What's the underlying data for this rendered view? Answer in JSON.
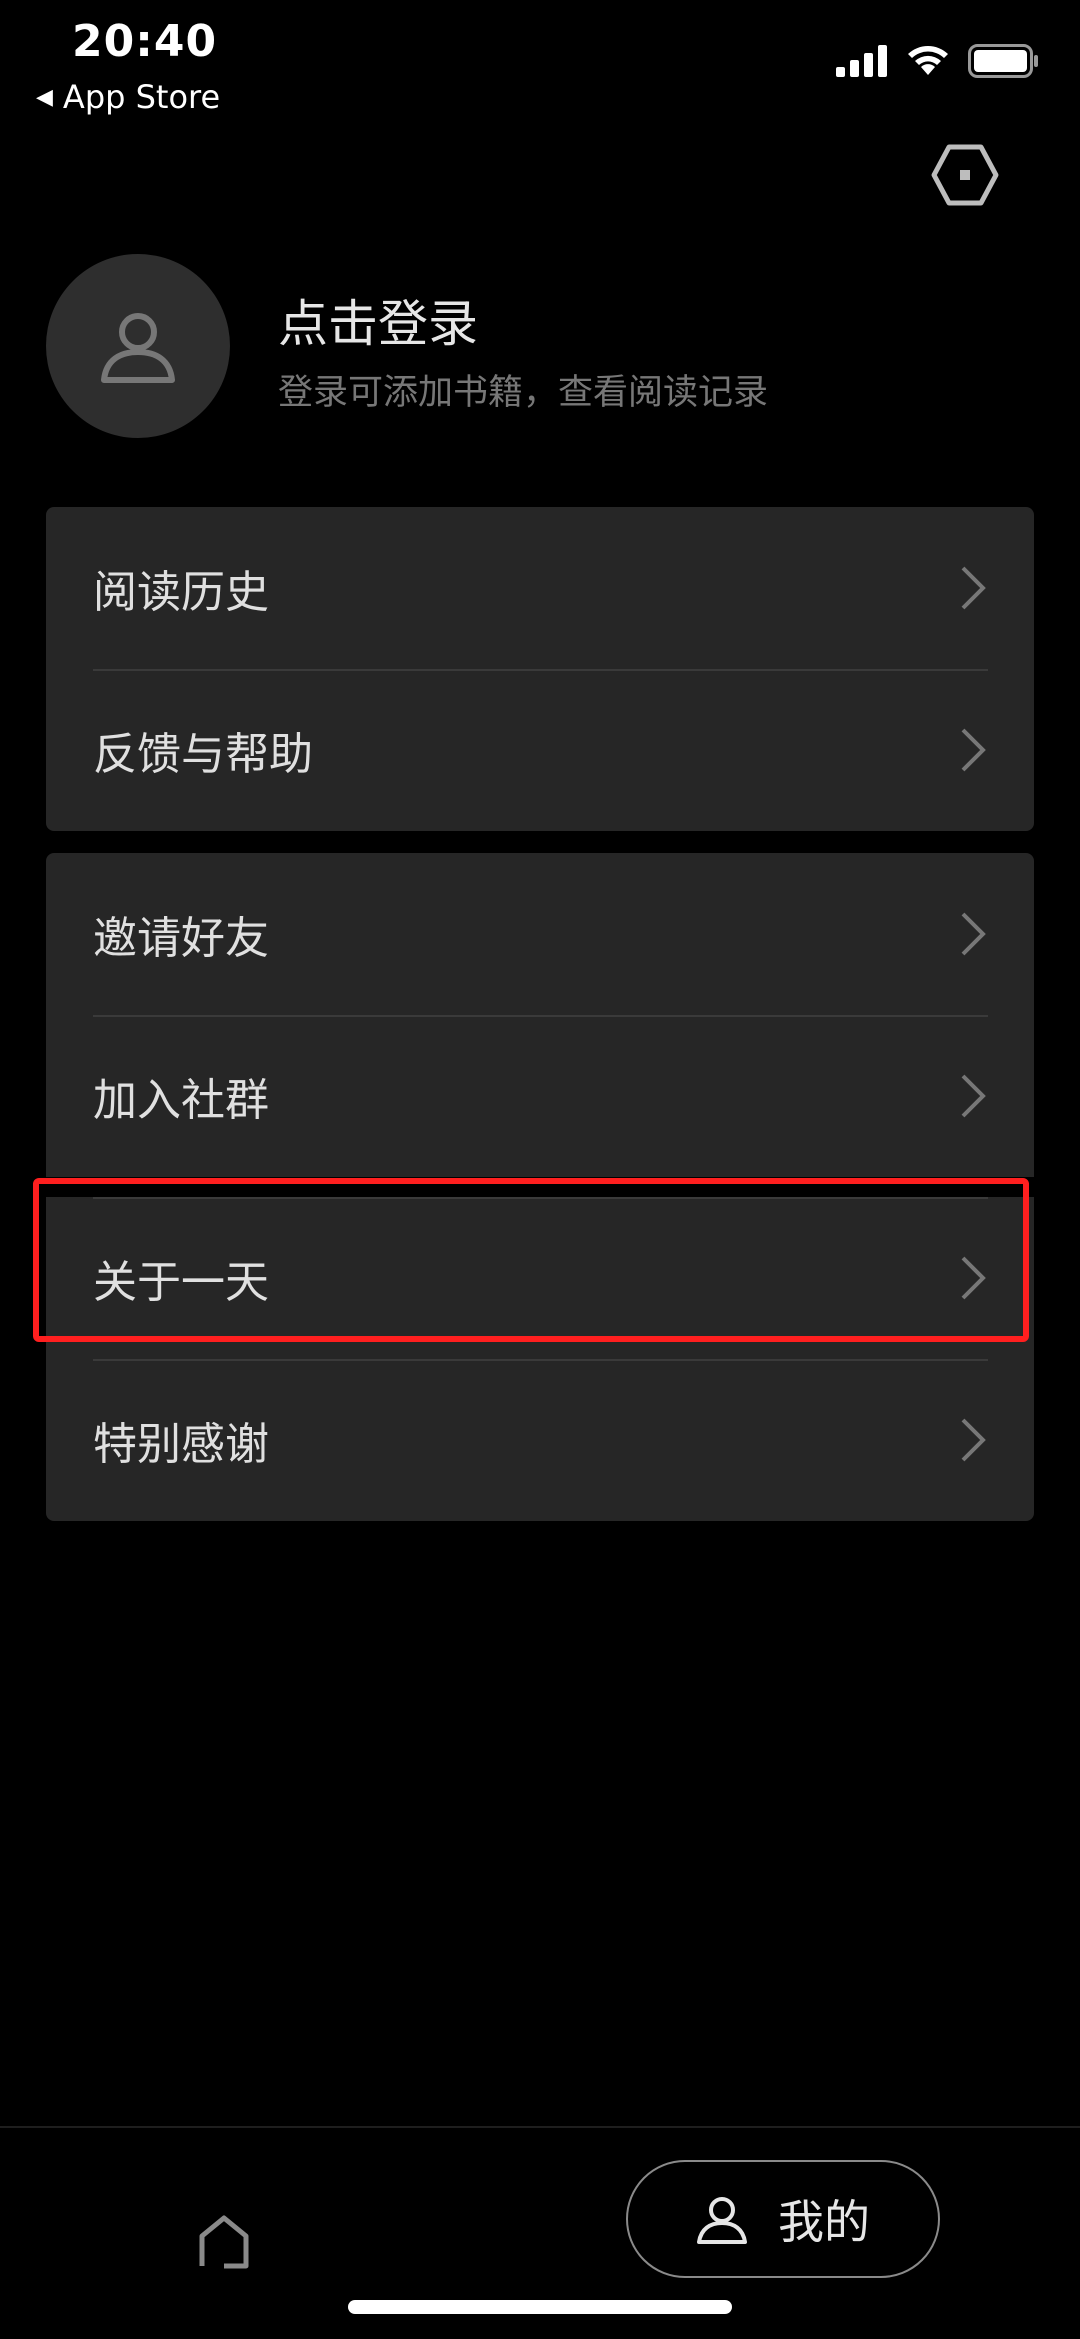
{
  "status_bar": {
    "time": "20:40",
    "back_label": "App Store",
    "signal_icon": "signal-icon",
    "wifi_icon": "wifi-icon",
    "battery_icon": "battery-icon"
  },
  "header": {
    "settings_icon": "hexagon-settings-icon"
  },
  "profile": {
    "title": "点击登录",
    "subtitle": "登录可添加书籍，查看阅读记录",
    "avatar_icon": "user-icon"
  },
  "menu": {
    "group1": [
      {
        "label": "阅读历史"
      },
      {
        "label": "反馈与帮助"
      }
    ],
    "group2": [
      {
        "label": "邀请好友"
      },
      {
        "label": "加入社群"
      },
      {
        "label": "关于一天"
      },
      {
        "label": "特别感谢"
      }
    ]
  },
  "tabbar": {
    "home_icon": "home-icon",
    "mine_icon": "user-icon",
    "mine_label": "我的"
  },
  "colors": {
    "background": "#000000",
    "card": "#262626",
    "highlight": "#ff1f1f"
  }
}
